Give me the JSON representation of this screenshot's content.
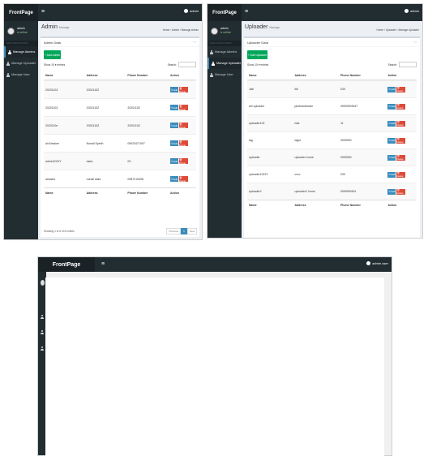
{
  "screens": [
    {
      "brand": "FrontPage",
      "menu_icon": "≡",
      "user_label": "admin",
      "sidebar": {
        "user_name": "admin",
        "user_status": "● online",
        "header": "MAIN NAVIGATION",
        "items": [
          "Manage Admins",
          "Manage Uploader",
          "Manage User"
        ],
        "active_index": 0
      },
      "content": {
        "title": "Admin",
        "subtitle": "Manage",
        "breadcrumb": "Home › Admin › Manage Admin",
        "box_title": "Admin Data",
        "box_tools": "− ×",
        "add_label": "+ Add Admin",
        "show_entries": "Show  10  ▾ entries",
        "search_label": "Search:",
        "columns": [
          "Name",
          "Address",
          "Phone Number",
          "Action"
        ],
        "rows": [
          [
            "2020110Z",
            "2020110Z",
            "",
            ""
          ],
          [
            "2020110Z",
            "2020110Z",
            "2020110Z",
            ""
          ],
          [
            "2020110n",
            "2020110Z",
            "2020110Z",
            ""
          ],
          [
            "ali Ahsaine",
            "Nonali Syedh",
            "09023471007",
            ""
          ],
          [
            "admin1023Y",
            "dadu",
            "09",
            ""
          ],
          [
            "ahsaine",
            "nonali wala",
            "0987210008",
            ""
          ]
        ],
        "footer": [
          "Name",
          "Address",
          "Phone Number",
          "Action"
        ],
        "edit_label": "✎ Edit",
        "delete_label": "🗑 Delete",
        "info": "Showing 1 to 6 of 6 entries",
        "pagination": [
          "Previous",
          "1",
          "Next"
        ]
      }
    },
    {
      "brand": "FrontPage",
      "menu_icon": "≡",
      "user_label": "admin",
      "sidebar": {
        "user_name": "admin",
        "user_status": "● online",
        "header": "MAIN NAVIGATION",
        "items": [
          "Manage Admins",
          "Manage Uploader",
          "Manage User"
        ],
        "active_index": 1
      },
      "content": {
        "title": "Uploader",
        "subtitle": "Manage",
        "breadcrumb": "Home › Uploader › Manage Uploader",
        "box_title": "Uploader Data",
        "box_tools": "− ×",
        "add_label": "+ Add Uploader",
        "show_entries": "Show  10  ▾ entries",
        "search_label": "Search:",
        "columns": [
          "Name",
          "Address",
          "Phone Number",
          "Action"
        ],
        "rows": [
          [
            "Jlali",
            "lilit",
            "030",
            ""
          ],
          [
            "ahi uploader",
            "jandhanthadar",
            "09090909047",
            ""
          ],
          [
            "uploader102",
            "bda",
            "11",
            ""
          ],
          [
            "tag",
            "tagur",
            "0909090",
            ""
          ],
          [
            "uploader",
            "uploader home",
            "0909090",
            ""
          ],
          [
            "uploader1022Y",
            "cccc",
            "030",
            ""
          ],
          [
            "uploader2",
            "uploader2 home",
            "0909090901",
            ""
          ]
        ],
        "footer": [
          "Name",
          "Address",
          "Phone Number",
          "Action"
        ],
        "edit_label": "✎ Edit",
        "delete_label": "🗑 Delete"
      }
    },
    {
      "brand": "FrontPage",
      "menu_icon": "≡",
      "user_label": "admin user"
    }
  ]
}
